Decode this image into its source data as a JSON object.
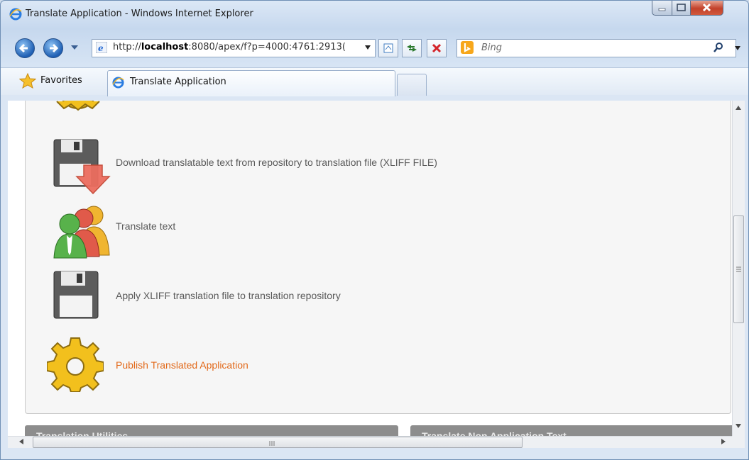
{
  "window": {
    "title": "Translate Application - Windows Internet Explorer"
  },
  "address_bar": {
    "url_prefix": "http://",
    "url_host": "localhost",
    "url_rest": ":8080/apex/f?p=4000:4761:2913("
  },
  "search": {
    "placeholder": "Bing"
  },
  "favorites_bar": {
    "favorites_label": "Favorites",
    "tab_label": "Translate Application"
  },
  "content": {
    "items": [
      {
        "label": "Download translatable text from repository to translation file (XLIFF FILE)",
        "icon": "floppy-download-icon",
        "link": false
      },
      {
        "label": "Translate text",
        "icon": "users-group-icon",
        "link": false
      },
      {
        "label": "Apply XLIFF translation file to translation repository",
        "icon": "floppy-disk-icon",
        "link": false
      },
      {
        "label": "Publish Translated Application",
        "icon": "gear-icon",
        "link": true
      }
    ],
    "sections": [
      {
        "title": "Translation Utilities"
      },
      {
        "title": "Translate Non Application Text"
      }
    ]
  },
  "colors": {
    "link": "#e2691a",
    "text": "#5a5a5a",
    "section_header": "#8d8d8d"
  }
}
